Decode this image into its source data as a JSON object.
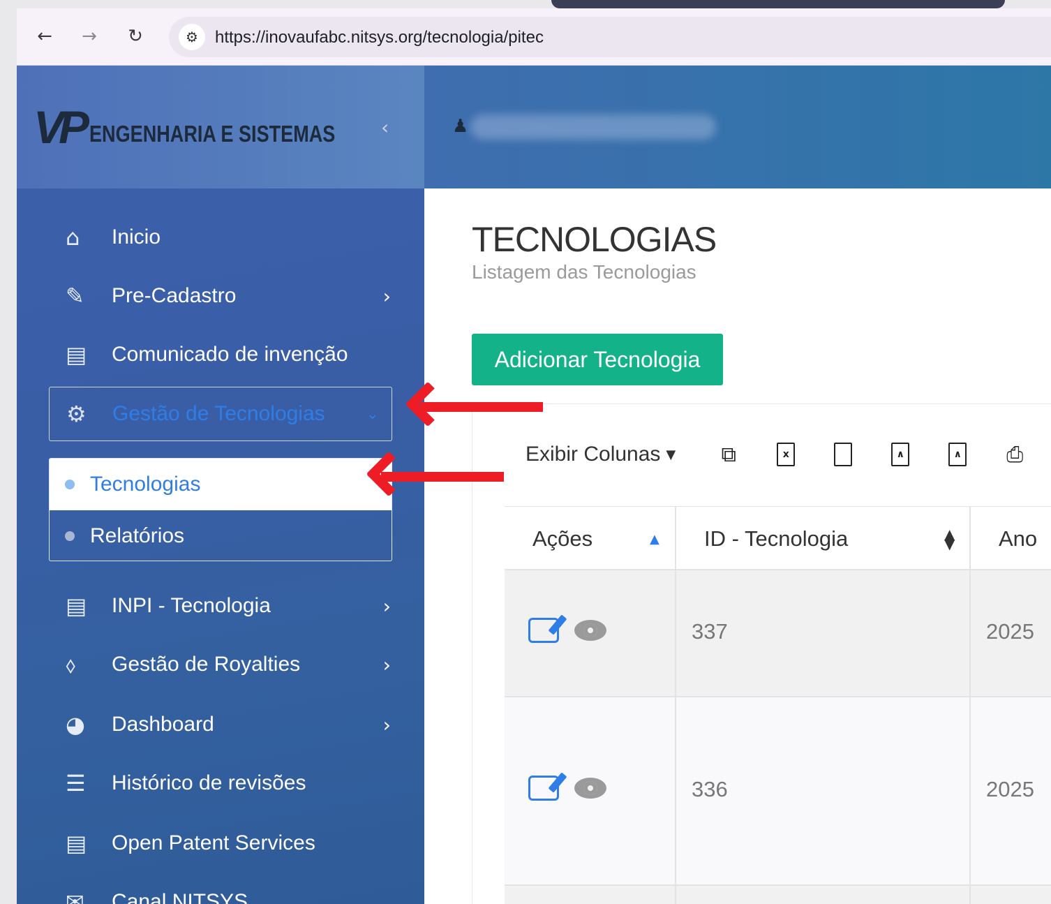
{
  "browser": {
    "url": "https://inovaufabc.nitsys.org/tecnologia/pitec",
    "back_icon": "arrow-left-icon",
    "forward_icon": "arrow-right-icon",
    "reload_icon": "reload-icon"
  },
  "brand": {
    "logo_letters": "VP",
    "logo_text": "ENGENHARIA E SISTEMAS"
  },
  "sidebar": {
    "items": [
      {
        "label": "Inicio",
        "icon": "home-icon"
      },
      {
        "label": "Pre-Cadastro",
        "icon": "edit-icon"
      },
      {
        "label": "Comunicado de invenção",
        "icon": "newspaper-icon"
      },
      {
        "label": "Gestão de Tecnologias",
        "icon": "gears-icon"
      },
      {
        "label": "INPI - Tecnologia",
        "icon": "newspaper-icon"
      },
      {
        "label": "Gestão de Royalties",
        "icon": "money-tag-icon"
      },
      {
        "label": "Dashboard",
        "icon": "dashboard-icon"
      },
      {
        "label": "Histórico de revisões",
        "icon": "list-icon"
      },
      {
        "label": "Open Patent Services",
        "icon": "newspaper-icon"
      },
      {
        "label": "Canal NITSYS",
        "icon": "envelope-icon"
      }
    ],
    "submenu": [
      {
        "label": "Tecnologias"
      },
      {
        "label": "Relatórios"
      }
    ]
  },
  "page": {
    "title": "TECNOLOGIAS",
    "subtitle": "Listagem das Tecnologias",
    "add_button": "Adicionar Tecnologia"
  },
  "toolbar": {
    "show_columns": "Exibir Colunas"
  },
  "table": {
    "headers": [
      "Ações",
      "ID - Tecnologia",
      "Ano"
    ],
    "rows": [
      {
        "id": "337",
        "ano": "2025"
      },
      {
        "id": "336",
        "ano": "2025"
      }
    ]
  },
  "colors": {
    "accent": "#2f7de6",
    "add_button": "#13b289",
    "annotation_arrow": "#ee1c24"
  }
}
